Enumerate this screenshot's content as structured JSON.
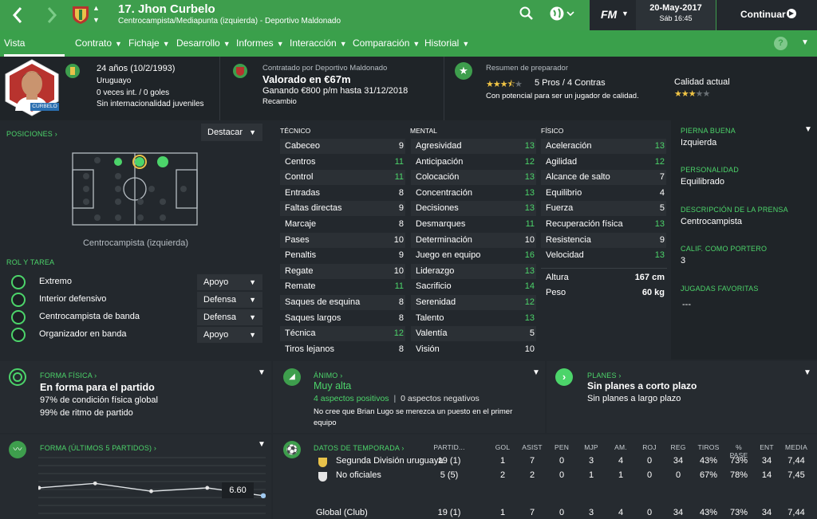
{
  "header": {
    "title": "17. Jhon Curbelo",
    "subtitle": "Centrocampista/Mediapunta (izquierda) - Deportivo Maldonado",
    "date": "20-May-2017",
    "time": "Sáb 16:45",
    "continue_label": "Continuar",
    "fm_logo": "FM"
  },
  "nav": [
    {
      "label": "Vista general",
      "active": true
    },
    {
      "label": "Contrato"
    },
    {
      "label": "Fichaje"
    },
    {
      "label": "Desarrollo"
    },
    {
      "label": "Informes"
    },
    {
      "label": "Interacción"
    },
    {
      "label": "Comparación"
    },
    {
      "label": "Historial"
    }
  ],
  "profile": {
    "age": "24 años (10/2/1993)",
    "nationality": "Uruguayo",
    "caps": "0 veces int. / 0 goles",
    "youth": "Sin internacionalidad juveniles",
    "shirt_name": "CURBELO"
  },
  "contract": {
    "label": "Contratado por Deportivo Maldonado",
    "value": "Valorado en €67m",
    "wage": "Ganando €800 p/m hasta 31/12/2018",
    "role": "Recambio"
  },
  "coach": {
    "label": "Resumen de preparador",
    "pros": "5 Pros / 4 Contras",
    "potential": "Con potencial para ser un jugador de calidad.",
    "current_label": "Calidad actual",
    "potential_stars": 3.5,
    "current_stars": 3
  },
  "positions": {
    "label": "POSICIONES",
    "highlight_label": "Destacar",
    "position_name": "Centrocampista (izquierda)"
  },
  "roles": {
    "label": "ROL Y TAREA",
    "items": [
      {
        "role": "Extremo",
        "duty": "Apoyo"
      },
      {
        "role": "Interior defensivo",
        "duty": "Defensa"
      },
      {
        "role": "Centrocampista de banda",
        "duty": "Defensa"
      },
      {
        "role": "Organizador en banda",
        "duty": "Apoyo"
      }
    ]
  },
  "attributes": {
    "technical_label": "TÉCNICO",
    "mental_label": "MENTAL",
    "physical_label": "FÍSICO",
    "technical": [
      {
        "name": "Cabeceo",
        "value": "9"
      },
      {
        "name": "Centros",
        "value": "11"
      },
      {
        "name": "Control",
        "value": "11"
      },
      {
        "name": "Entradas",
        "value": "8"
      },
      {
        "name": "Faltas directas",
        "value": "9"
      },
      {
        "name": "Marcaje",
        "value": "8"
      },
      {
        "name": "Pases",
        "value": "10"
      },
      {
        "name": "Penaltis",
        "value": "9"
      },
      {
        "name": "Regate",
        "value": "10"
      },
      {
        "name": "Remate",
        "value": "11"
      },
      {
        "name": "Saques de esquina",
        "value": "8"
      },
      {
        "name": "Saques largos",
        "value": "8"
      },
      {
        "name": "Técnica",
        "value": "12"
      },
      {
        "name": "Tiros lejanos",
        "value": "8"
      }
    ],
    "mental": [
      {
        "name": "Agresividad",
        "value": "13"
      },
      {
        "name": "Anticipación",
        "value": "12"
      },
      {
        "name": "Colocación",
        "value": "13"
      },
      {
        "name": "Concentración",
        "value": "13"
      },
      {
        "name": "Decisiones",
        "value": "13"
      },
      {
        "name": "Desmarques",
        "value": "11"
      },
      {
        "name": "Determinación",
        "value": "10"
      },
      {
        "name": "Juego en equipo",
        "value": "16"
      },
      {
        "name": "Liderazgo",
        "value": "13"
      },
      {
        "name": "Sacrificio",
        "value": "14"
      },
      {
        "name": "Serenidad",
        "value": "12"
      },
      {
        "name": "Talento",
        "value": "13"
      },
      {
        "name": "Valentía",
        "value": "5"
      },
      {
        "name": "Visión",
        "value": "10"
      }
    ],
    "physical": [
      {
        "name": "Aceleración",
        "value": "13"
      },
      {
        "name": "Agilidad",
        "value": "12"
      },
      {
        "name": "Alcance de salto",
        "value": "7"
      },
      {
        "name": "Equilibrio",
        "value": "4"
      },
      {
        "name": "Fuerza",
        "value": "5"
      },
      {
        "name": "Recuperación física",
        "value": "13"
      },
      {
        "name": "Resistencia",
        "value": "9"
      },
      {
        "name": "Velocidad",
        "value": "13"
      }
    ],
    "height_label": "Altura",
    "height": "167 cm",
    "weight_label": "Peso",
    "weight": "60 kg"
  },
  "side_info": {
    "foot_label": "PIERNA BUENA",
    "foot": "Izquierda",
    "personality_label": "PERSONALIDAD",
    "personality": "Equilibrado",
    "press_label": "DESCRIPCIÓN DE LA PRENSA",
    "press": "Centrocampista",
    "gk_label": "CALIF. COMO PORTERO",
    "gk": "3",
    "moves_label": "JUGADAS FAVORITAS",
    "moves": "---"
  },
  "fitness": {
    "label": "FORMA FÍSICA",
    "status": "En forma para el partido",
    "condition": "97% de condición física global",
    "sharpness": "99% de ritmo de partido"
  },
  "morale": {
    "label": "ÁNIMO",
    "status": "Muy alta",
    "positive": "4 aspectos positivos",
    "separator": "|",
    "negative": "0 aspectos negativos",
    "note": "No cree que Brian Lugo se merezca un puesto en el primer equipo"
  },
  "plans": {
    "label": "PLANES",
    "short": "Sin planes a corto plazo",
    "long": "Sin planes a largo plazo"
  },
  "form": {
    "label": "FORMA (ÚLTIMOS 5 PARTIDOS)",
    "last_rating": "6.60"
  },
  "season": {
    "label": "DATOS DE TEMPORADA",
    "headers": [
      "PARTID...",
      "GOL",
      "ASIST",
      "PEN",
      "MJP",
      "AM.",
      "ROJ",
      "REG",
      "TIROS",
      "% PASE",
      "ENT",
      "MEDIA"
    ],
    "rows": [
      {
        "comp": "Segunda División uruguaya",
        "values": [
          "19 (1)",
          "1",
          "7",
          "0",
          "3",
          "4",
          "0",
          "34",
          "43%",
          "73%",
          "34",
          "7,44"
        ]
      },
      {
        "comp": "No oficiales",
        "values": [
          "5 (5)",
          "2",
          "2",
          "0",
          "1",
          "1",
          "0",
          "0",
          "67%",
          "78%",
          "14",
          "7,45"
        ]
      }
    ],
    "total": {
      "comp": "Global (Club)",
      "values": [
        "19 (1)",
        "1",
        "7",
        "0",
        "3",
        "4",
        "0",
        "34",
        "43%",
        "73%",
        "34",
        "7,44"
      ]
    }
  },
  "chart_data": {
    "type": "line",
    "title": "FORMA (ÚLTIMOS 5 PARTIDOS)",
    "series": [
      {
        "values": [
          7.3,
          7.7,
          7.0,
          7.3,
          6.6
        ]
      }
    ],
    "ylim": [
      5,
      10
    ],
    "grid": true
  },
  "colors": {
    "accent": "#3e9e4d",
    "green_text": "#4cd46a",
    "background": "#23282d"
  }
}
